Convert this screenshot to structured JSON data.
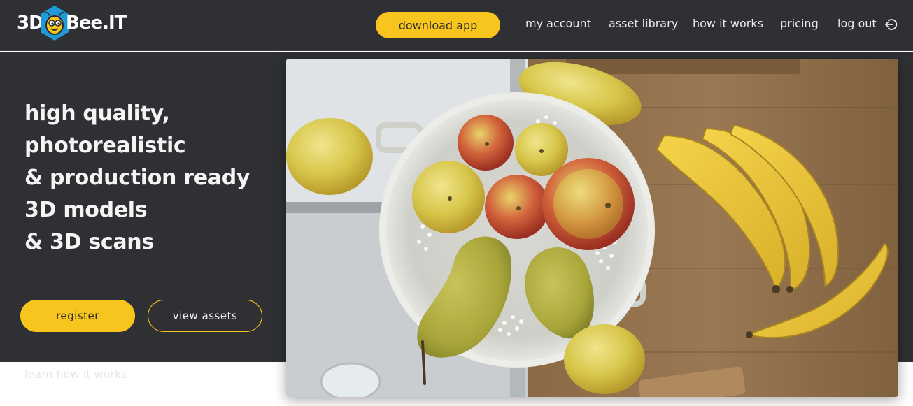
{
  "header": {
    "logo": {
      "text_left": "3D",
      "text_right": "Bee.IT"
    },
    "download_label": "download app",
    "nav": [
      {
        "label": "my account"
      },
      {
        "label": "asset library"
      },
      {
        "label": "how it works"
      },
      {
        "label": "pricing"
      },
      {
        "label": "log out"
      }
    ]
  },
  "hero": {
    "headline": [
      "high quality,",
      "photorealistic",
      "& production ready",
      "3D models",
      "& 3D scans"
    ],
    "register_label": "register",
    "view_assets_label": "view assets",
    "learn_link": "learn how it works"
  },
  "icons": {
    "logout": "logout-icon",
    "logo": "bee-hexagon-logo"
  },
  "colors": {
    "background": "#2f3033",
    "accent": "#f7c51e",
    "text": "#f4f4f4",
    "logo_blue": "#1f9ad6"
  }
}
